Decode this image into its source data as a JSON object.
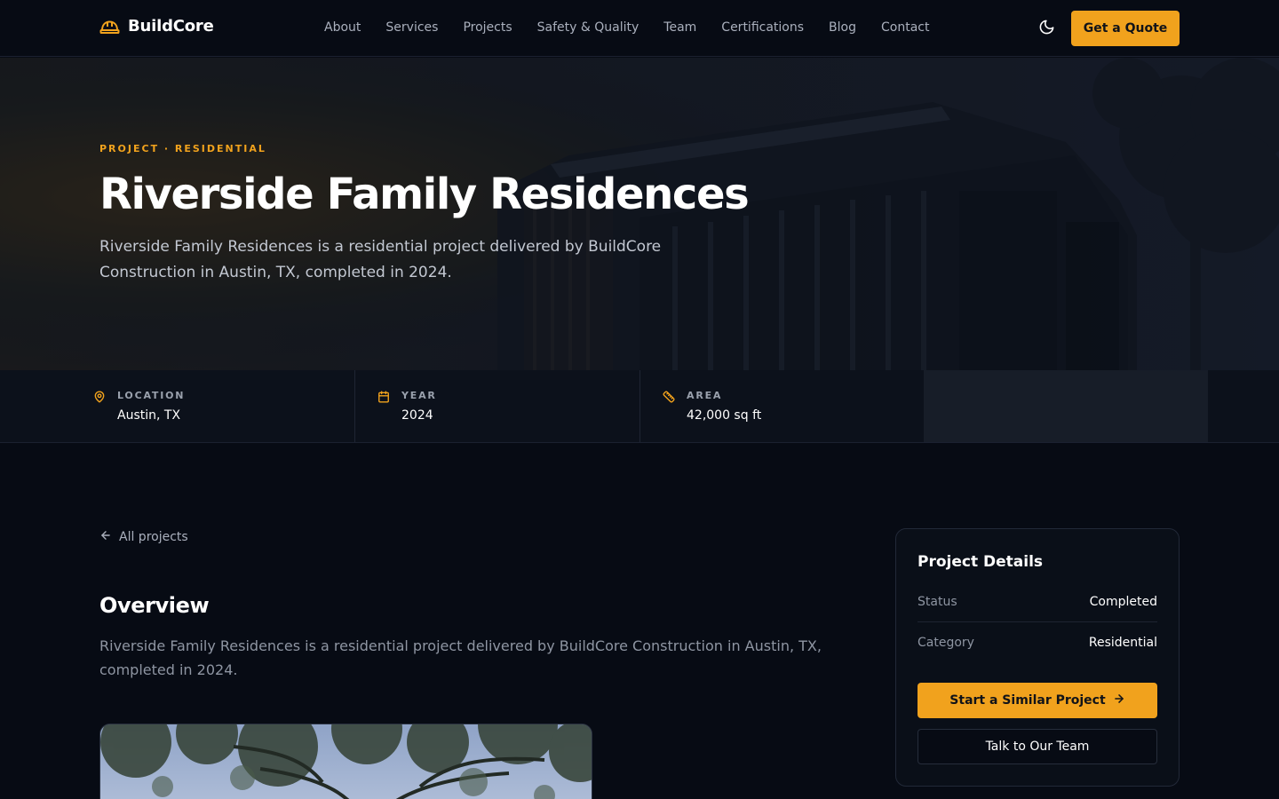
{
  "brand": {
    "name": "BuildCore",
    "icon": "hard-hat-icon",
    "accent": "#f1a21d"
  },
  "nav": {
    "links": [
      "About",
      "Services",
      "Projects",
      "Safety & Quality",
      "Team",
      "Certifications",
      "Blog",
      "Contact"
    ],
    "theme_toggle_icon": "moon-icon",
    "cta_label": "Get a Quote"
  },
  "hero": {
    "eyebrow": "PROJECT · RESIDENTIAL",
    "title": "Riverside Family Residences",
    "description": "Riverside Family Residences is a residential project delivered by BuildCore Construction in Austin, TX, completed in 2024."
  },
  "stats": [
    {
      "label": "LOCATION",
      "value": "Austin, TX",
      "icon": "map-pin-icon"
    },
    {
      "label": "YEAR",
      "value": "2024",
      "icon": "calendar-icon"
    },
    {
      "label": "AREA",
      "value": "42,000 sq ft",
      "icon": "ruler-icon"
    }
  ],
  "main": {
    "back_label": "All projects",
    "overview_title": "Overview",
    "overview_text": "Riverside Family Residences is a residential project delivered by BuildCore Construction in Austin, TX, completed in 2024."
  },
  "details": {
    "title": "Project Details",
    "rows": [
      {
        "key": "Status",
        "value": "Completed"
      },
      {
        "key": "Category",
        "value": "Residential"
      }
    ],
    "primary_cta": "Start a Similar Project",
    "secondary_cta": "Talk to Our Team"
  }
}
